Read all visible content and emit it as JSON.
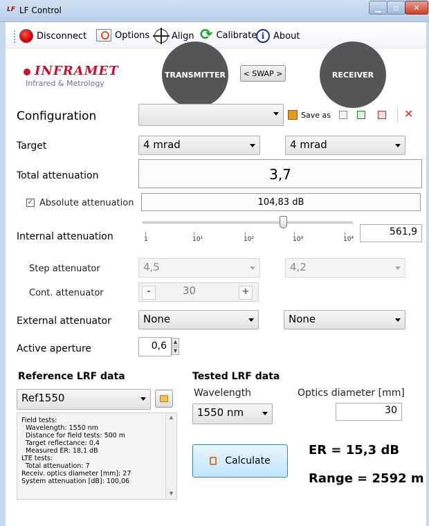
{
  "window": {
    "app_icon": "LF",
    "title": "LF Control"
  },
  "toolbar": {
    "disconnect": "Disconnect",
    "options": "Options",
    "align": "Align",
    "calibrate": "Calibrate",
    "about": "About",
    "about_icon_glyph": "i"
  },
  "logo": {
    "name": "INFRAMET",
    "subtitle": "Infrared & Metrology"
  },
  "header": {
    "transmitter": "TRANSMITTER",
    "swap": "< SWAP >",
    "receiver": "RECEIVER"
  },
  "configuration": {
    "label": "Configuration",
    "value": "",
    "save_as": "Save as"
  },
  "target": {
    "label": "Target",
    "value_left": "4 mrad",
    "value_right": "4 mrad"
  },
  "total_attenuation": {
    "label": "Total attenuation",
    "value": "3,7"
  },
  "absolute_attenuation": {
    "label": "Absolute attenuation",
    "checked": true,
    "value": "104,83 dB"
  },
  "internal_attenuation": {
    "label": "Internal attenuation",
    "ticks": [
      "1",
      "10¹",
      "10²",
      "10³",
      "10⁴"
    ],
    "value": "561,9"
  },
  "step_attenuator": {
    "label": "Step attenuator",
    "value_left": "4,5",
    "value_right": "4,2"
  },
  "cont_attenuator": {
    "label": "Cont. attenuator",
    "minus": "-",
    "value": "30",
    "plus": "+"
  },
  "external_attenuator": {
    "label": "External attenuator",
    "value_left": "None",
    "value_right": "None"
  },
  "active_aperture": {
    "label": "Active aperture",
    "value": "0,6"
  },
  "reference": {
    "title": "Reference LRF data",
    "selected": "Ref1550",
    "info_lines": [
      "Field tests:",
      "  Wavelength: 1550 nm",
      "  Distance for field tests: 500 m",
      "  Target reflectance: 0,4",
      "  Measured ER: 18,1 dB",
      "LTE tests:",
      "  Total attenuation: 7",
      "Receiv. optics diameter [mm]: 27",
      "System attenuation [dB]: 100,06"
    ]
  },
  "tested": {
    "title": "Tested LRF data",
    "wavelength_label": "Wavelength",
    "wavelength_value": "1550 nm",
    "optics_label": "Optics diameter [mm]",
    "optics_value": "30"
  },
  "calculate": {
    "label": "Calculate"
  },
  "results": {
    "er": "ER = 15,3 dB",
    "range": "Range = 2592 m"
  }
}
